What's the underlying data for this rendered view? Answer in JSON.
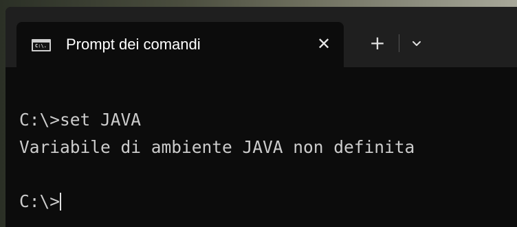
{
  "window": {
    "tab_title": "Prompt dei comandi",
    "tab_icon_text": "C:\\.",
    "close_glyph": "✕",
    "new_tab_glyph": "+"
  },
  "terminal": {
    "lines": [
      "C:\\>set JAVA",
      "Variabile di ambiente JAVA non definita",
      "",
      "C:\\>"
    ]
  },
  "colors": {
    "terminal_bg": "#0c0c0c",
    "titlebar_bg": "#1f1f1f",
    "text": "#cccccc"
  },
  "icons": [
    "cmd-icon",
    "close-icon",
    "plus-icon",
    "chevron-down-icon"
  ]
}
